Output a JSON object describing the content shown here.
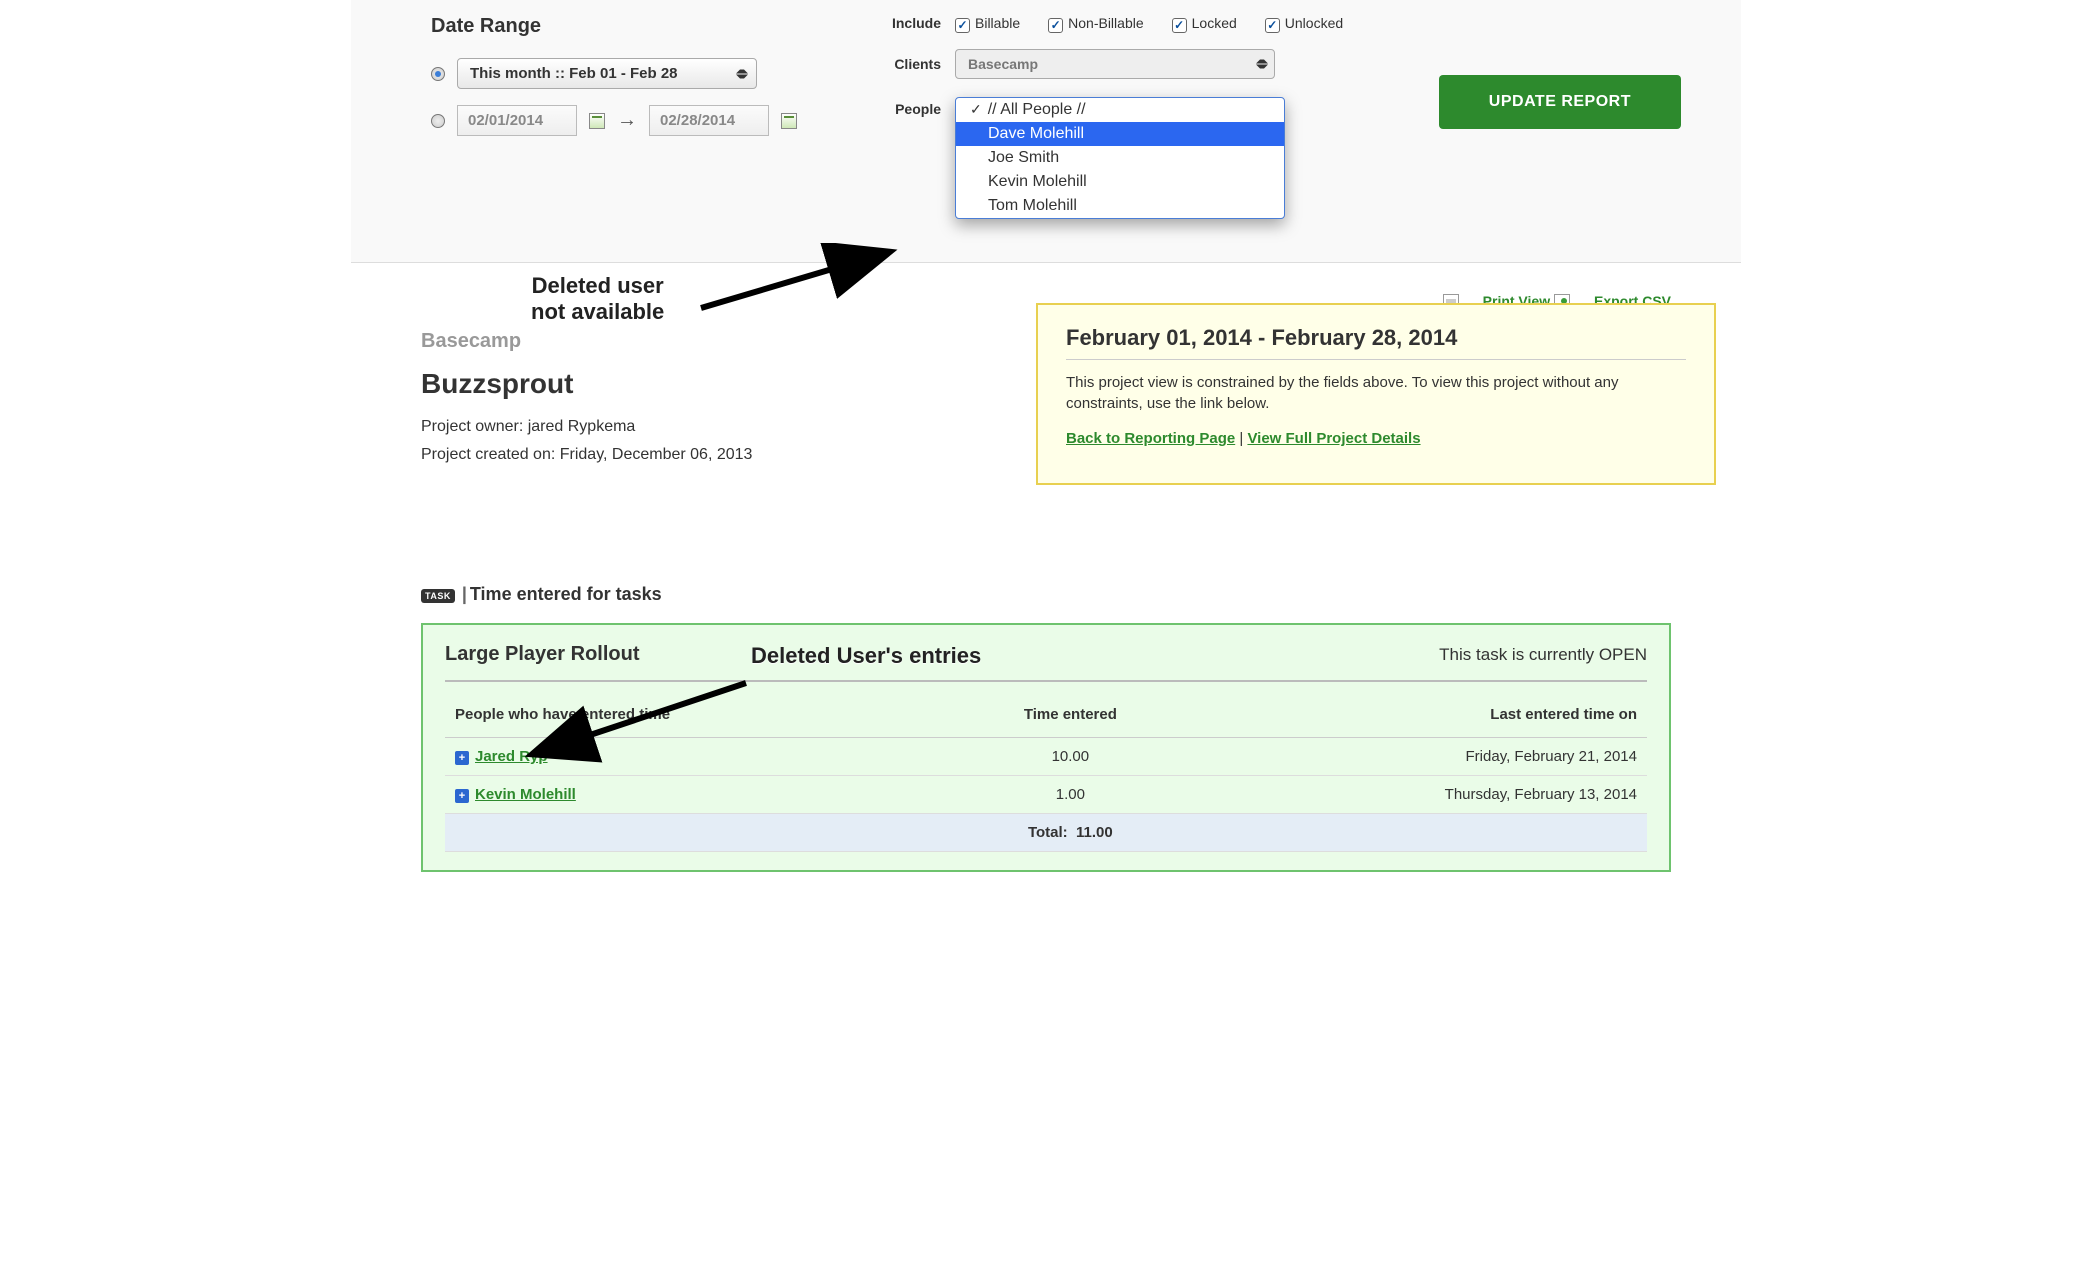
{
  "filters": {
    "date_range_title": "Date Range",
    "range_select": "This month :: Feb 01 - Feb 28",
    "date_from": "02/01/2014",
    "date_to": "02/28/2014",
    "include_label": "Include",
    "include_options": [
      "Billable",
      "Non-Billable",
      "Locked",
      "Unlocked"
    ],
    "clients_label": "Clients",
    "clients_value": "Basecamp",
    "people_label": "People",
    "people_options": {
      "all": "// All People //",
      "highlighted": "Dave Molehill",
      "rest": [
        "Joe Smith",
        "Kevin Molehill",
        "Tom Molehill"
      ]
    },
    "update_btn": "UPDATE REPORT"
  },
  "export": {
    "print": "Print View",
    "csv": "Export CSV"
  },
  "project": {
    "client": "Basecamp",
    "name": "Buzzsprout",
    "owner_label": "Project owner: jared Rypkema",
    "created_label": "Project created on: Friday, December 06, 2013"
  },
  "info_box": {
    "title": "February 01, 2014 - February 28, 2014",
    "desc": "This project view is constrained by the fields above. To view this project without any constraints, use the link below.",
    "back_link": "Back to Reporting Page",
    "sep": " | ",
    "full_link": "View Full Project Details"
  },
  "tasks_section": {
    "badge": "TASK",
    "heading": "Time entered for tasks"
  },
  "task": {
    "name": "Large Player Rollout",
    "status": "This task is currently OPEN",
    "cols": [
      "People who have entered time",
      "Time entered",
      "Last entered time on"
    ],
    "rows": [
      {
        "name": "Jared Ryp",
        "time": "10.00",
        "last": "Friday, February 21, 2014"
      },
      {
        "name": "Kevin Molehill",
        "time": "1.00",
        "last": "Thursday, February 13, 2014"
      }
    ],
    "total_label": "Total:",
    "total_value": "11.00"
  },
  "annotations": {
    "a1": "Deleted user\nnot available",
    "a2": "Deleted User's entries"
  }
}
